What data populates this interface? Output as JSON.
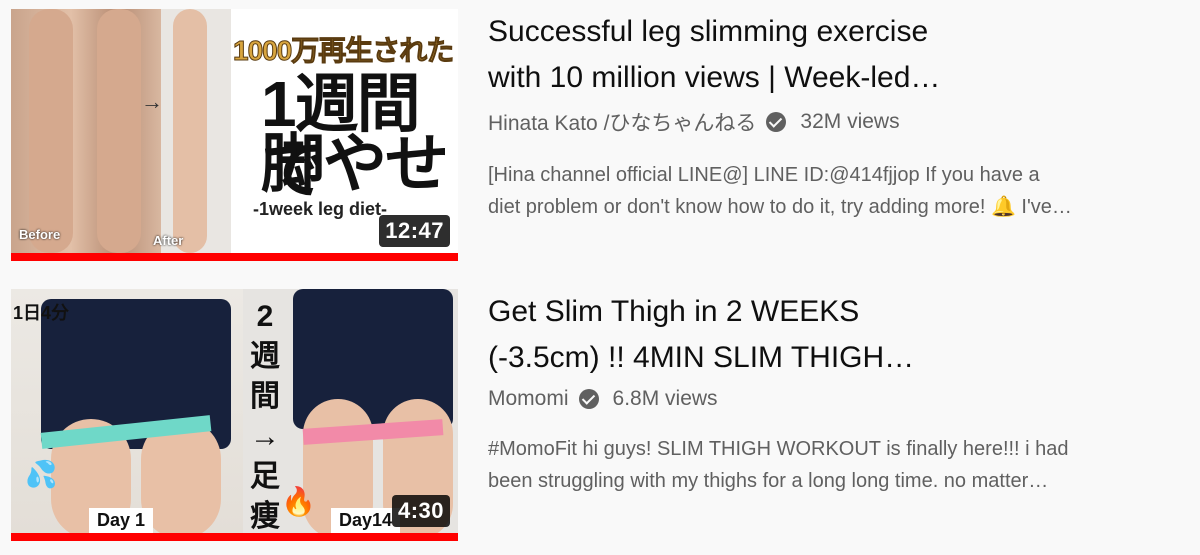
{
  "videos": [
    {
      "title_lines": [
        "Successful leg slimming exercise",
        "with 10 million views | Week-led…"
      ],
      "channel": "Hinata Kato /ひなちゃんねる",
      "views": "32M views",
      "description_lines": [
        "[Hina channel official LINE@] LINE ID:@414fjjop If you have a",
        "diet problem or don't know how to do it, try adding more! 🔔 I've…"
      ],
      "duration": "12:47",
      "watched_fraction": 1.0,
      "thumbnail_text": {
        "top": "1000万再生された",
        "line1": "1週間で",
        "line2": "脚やせ",
        "sub": "-1week leg diet-",
        "before": "Before",
        "after": "After"
      }
    },
    {
      "title_lines": [
        "Get Slim Thigh in 2 WEEKS",
        "(-3.5cm) !! 4MIN SLIM THIGH…"
      ],
      "channel": "Momomi",
      "views": "6.8M views",
      "description_lines": [
        "#MomoFit hi guys! SLIM THIGH WORKOUT is finally here!!! i had",
        "been struggling with my thighs for a long long time. no matter…"
      ],
      "duration": "4:30",
      "watched_fraction": 1.0,
      "thumbnail_text": {
        "badge": "1日4分",
        "vertical": "2週間→足痩せ",
        "day_left": "Day 1",
        "day_right": "Day14"
      }
    }
  ],
  "colors": {
    "background": "#f9f9f9",
    "progress": "#ff0000",
    "title": "#0f0f0f",
    "meta": "#606060"
  },
  "icons": {
    "verified": "verified-check-icon"
  }
}
